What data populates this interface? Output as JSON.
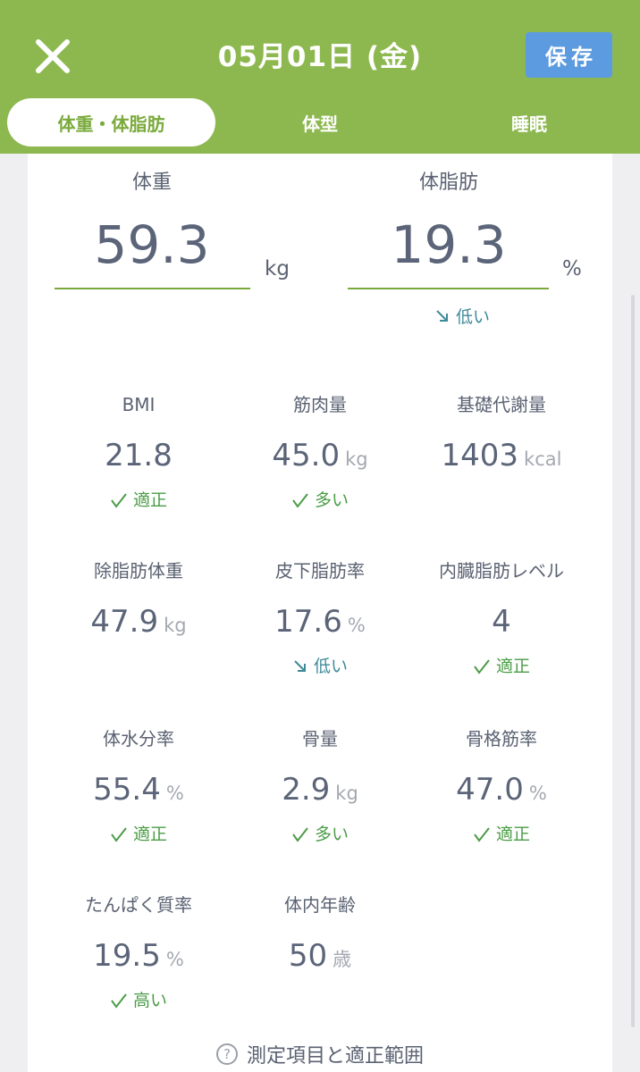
{
  "header": {
    "date": "05月01日 (金)",
    "save_label": "保存",
    "tabs": [
      "体重・体脂肪",
      "体型",
      "睡眠"
    ]
  },
  "main": {
    "weight": {
      "label": "体重",
      "value": "59.3",
      "unit": "kg"
    },
    "body_fat": {
      "label": "体脂肪",
      "value": "19.3",
      "unit": "%",
      "status": "低い"
    }
  },
  "metrics": [
    {
      "label": "BMI",
      "value": "21.8",
      "unit": "",
      "status": "適正"
    },
    {
      "label": "筋肉量",
      "value": "45.0",
      "unit": "kg",
      "status": "多い"
    },
    {
      "label": "基礎代謝量",
      "value": "1403",
      "unit": "kcal",
      "status": ""
    },
    {
      "label": "除脂肪体重",
      "value": "47.9",
      "unit": "kg",
      "status": ""
    },
    {
      "label": "皮下脂肪率",
      "value": "17.6",
      "unit": "%",
      "status": "低い"
    },
    {
      "label": "内臓脂肪レベル",
      "value": "4",
      "unit": "",
      "status": "適正"
    },
    {
      "label": "体水分率",
      "value": "55.4",
      "unit": "%",
      "status": "適正"
    },
    {
      "label": "骨量",
      "value": "2.9",
      "unit": "kg",
      "status": "多い"
    },
    {
      "label": "骨格筋率",
      "value": "47.0",
      "unit": "%",
      "status": "適正"
    },
    {
      "label": "たんぱく質率",
      "value": "19.5",
      "unit": "%",
      "status": "高い"
    },
    {
      "label": "体内年齢",
      "value": "50",
      "unit": "歳",
      "status": ""
    }
  ],
  "footer": {
    "link_label": "測定項目と適正範囲"
  },
  "icons": {
    "close": "close-icon",
    "check": "check-icon",
    "down_arrow": "arrow-down-right-icon",
    "help": "question-circle-icon"
  },
  "colors": {
    "header_bg": "#8db84f",
    "save_button": "#5d9be0",
    "good": "#4a9c45",
    "low": "#3e8a9a"
  }
}
